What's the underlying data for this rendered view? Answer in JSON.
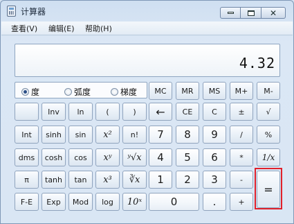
{
  "window": {
    "title": "计算器"
  },
  "menu": [
    "查看(V)",
    "编辑(E)",
    "帮助(H)"
  ],
  "display": {
    "value": "4.32"
  },
  "angle_modes": [
    {
      "label": "度",
      "selected": true
    },
    {
      "label": "弧度",
      "selected": false
    },
    {
      "label": "梯度",
      "selected": false
    }
  ],
  "memory_keys": [
    "MC",
    "MR",
    "MS",
    "M+",
    "M-"
  ],
  "rows": [
    [
      "",
      "Inv",
      "ln",
      "(",
      ")",
      "←",
      "CE",
      "C",
      "±",
      "√"
    ],
    [
      "Int",
      "sinh",
      "sin",
      "x²",
      "n!",
      "7",
      "8",
      "9",
      "/",
      "%"
    ],
    [
      "dms",
      "cosh",
      "cos",
      "xʸ",
      "ʸ√x",
      "4",
      "5",
      "6",
      "*",
      "1/x"
    ],
    [
      "π",
      "tanh",
      "tan",
      "x³",
      "∛x",
      "1",
      "2",
      "3",
      "-",
      "="
    ],
    [
      "F-E",
      "Exp",
      "Mod",
      "log",
      "10ˣ",
      "0",
      ".",
      "+"
    ]
  ]
}
